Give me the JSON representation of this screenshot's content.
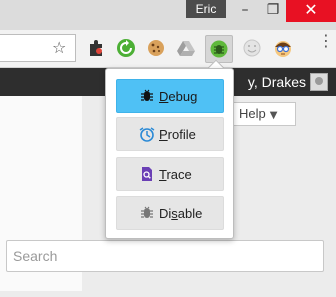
{
  "window": {
    "profile_name": "Eric",
    "minimize_glyph": "–",
    "restore_glyph": "❐",
    "close_glyph": "✕"
  },
  "toolbar": {
    "bookmark_star": "☆",
    "extensions": [
      "puzzle-extension-icon",
      "green-refresh-extension-icon",
      "cookie-extension-icon",
      "drive-extension-icon",
      "xdebug-helper-icon",
      "smiley-extension-icon",
      "nerd-face-extension-icon"
    ],
    "menu_glyph": "⋮"
  },
  "page": {
    "greeting": "y, Drakes",
    "help_label": "Help",
    "help_caret": "▼",
    "search_placeholder": "Search"
  },
  "popup": {
    "items": [
      {
        "pre": "",
        "acc": "D",
        "post": "ebug",
        "icon": "bug-icon",
        "color": "#4fc1f5"
      },
      {
        "pre": "",
        "acc": "P",
        "post": "rofile",
        "icon": "clock-icon",
        "color": "#e6e6e6"
      },
      {
        "pre": "",
        "acc": "T",
        "post": "race",
        "icon": "trace-file-icon",
        "color": "#e6e6e6"
      },
      {
        "pre": "Di",
        "acc": "s",
        "post": "able",
        "icon": "bug-disabled-icon",
        "color": "#e6e6e6"
      }
    ]
  }
}
